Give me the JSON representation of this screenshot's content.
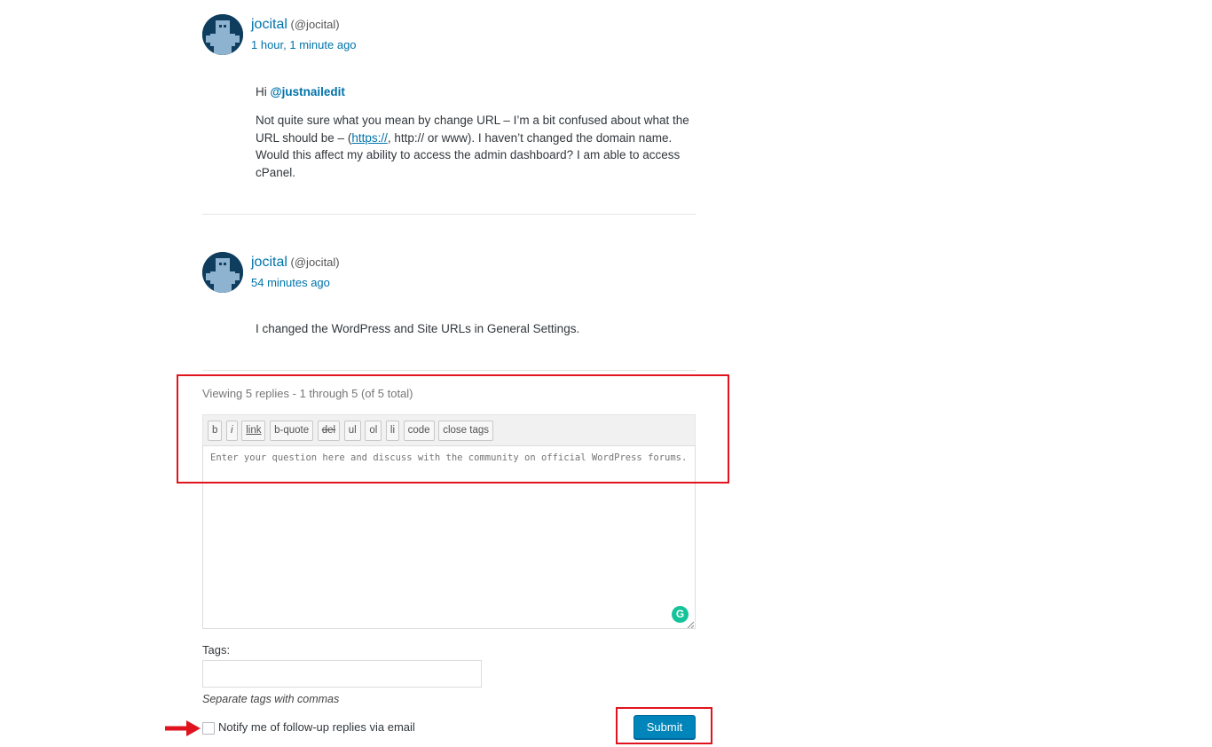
{
  "replies": [
    {
      "author_name": "jocital",
      "author_handle": "(@jocital)",
      "timestamp": "1 hour, 1 minute ago",
      "greeting_prefix": "Hi ",
      "mention": "@justnailedit",
      "body_parts": {
        "a": "Not quite sure what you mean by change URL – I’m a bit confused about what the URL should be – (",
        "link": "https://",
        "b": ", http:// or www). I haven’t changed the domain name. Would this affect my ability to access the admin dashboard? I am able to access cPanel."
      }
    },
    {
      "author_name": "jocital",
      "author_handle": "(@jocital)",
      "timestamp": "54 minutes ago",
      "body": "I changed the WordPress and Site URLs in General Settings."
    }
  ],
  "viewing_text": "Viewing 5 replies - 1 through 5 (of 5 total)",
  "toolbar": {
    "buttons": [
      "b",
      "i",
      "link",
      "b-quote",
      "del",
      "ul",
      "ol",
      "li",
      "code",
      "close tags"
    ]
  },
  "editor": {
    "placeholder": "Enter your question here and discuss with the community on official WordPress forums."
  },
  "grammarly_icon": "G",
  "tags": {
    "label": "Tags:",
    "value": "",
    "hint": "Separate tags with commas"
  },
  "notify": {
    "label": "Notify me of follow-up replies via email",
    "checked": false
  },
  "submit_label": "Submit",
  "colors": {
    "link": "#0073aa",
    "button": "#0085ba",
    "highlight": "#e0141e",
    "avatar": "#0f3d5e"
  }
}
